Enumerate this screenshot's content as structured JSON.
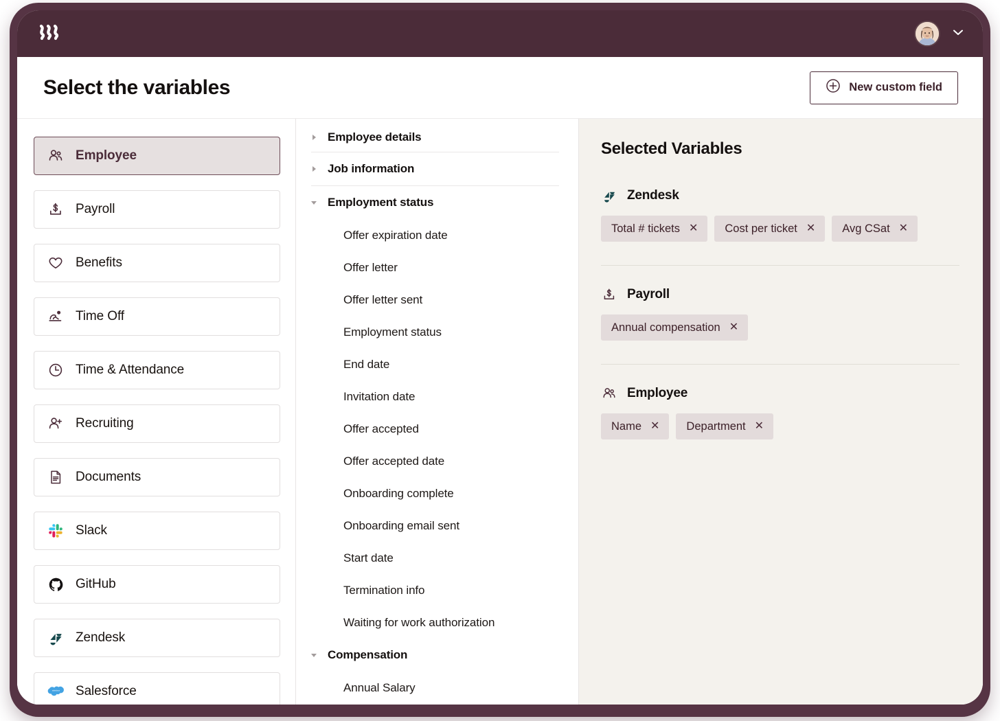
{
  "appbar": {
    "logo_name": "rippling-logo",
    "avatar_name": "user-avatar",
    "chevron_name": "chevron-down-icon"
  },
  "header": {
    "title": "Select the variables",
    "new_field_button": "New custom field",
    "new_field_icon": "plus-circle-icon"
  },
  "sidebar": {
    "items": [
      {
        "label": "Employee",
        "icon": "people-icon",
        "selected": true
      },
      {
        "label": "Payroll",
        "icon": "dollar-tray-icon",
        "selected": false
      },
      {
        "label": "Benefits",
        "icon": "heart-icon",
        "selected": false
      },
      {
        "label": "Time Off",
        "icon": "person-relax-icon",
        "selected": false
      },
      {
        "label": "Time & Attendance",
        "icon": "clock-icon",
        "selected": false
      },
      {
        "label": "Recruiting",
        "icon": "person-plus-icon",
        "selected": false
      },
      {
        "label": "Documents",
        "icon": "document-icon",
        "selected": false
      },
      {
        "label": "Slack",
        "icon": "slack-icon",
        "selected": false
      },
      {
        "label": "GitHub",
        "icon": "github-icon",
        "selected": false
      },
      {
        "label": "Zendesk",
        "icon": "zendesk-icon",
        "selected": false
      },
      {
        "label": "Salesforce",
        "icon": "salesforce-icon",
        "selected": false
      }
    ]
  },
  "variables_tree": {
    "groups": [
      {
        "label": "Employee details",
        "expanded": false,
        "items": []
      },
      {
        "label": "Job information",
        "expanded": false,
        "items": []
      },
      {
        "label": "Employment status",
        "expanded": true,
        "items": [
          "Offer expiration date",
          "Offer letter",
          "Offer letter sent",
          "Employment status",
          "End date",
          "Invitation date",
          "Offer accepted",
          "Offer accepted date",
          "Onboarding complete",
          "Onboarding email sent",
          "Start date",
          "Termination info",
          "Waiting for work authorization"
        ]
      },
      {
        "label": "Compensation",
        "expanded": true,
        "items": [
          "Annual Salary"
        ]
      }
    ]
  },
  "selected_panel": {
    "title": "Selected Variables",
    "groups": [
      {
        "label": "Zendesk",
        "icon": "zendesk-icon",
        "chips": [
          "Total # tickets",
          "Cost per ticket",
          "Avg CSat"
        ]
      },
      {
        "label": "Payroll",
        "icon": "dollar-tray-icon",
        "chips": [
          "Annual compensation"
        ]
      },
      {
        "label": "Employee",
        "icon": "people-icon",
        "chips": [
          "Name",
          "Department"
        ]
      }
    ],
    "chip_remove_glyph": "✕"
  },
  "colors": {
    "frame": "#563444",
    "appbar": "#4b2c39",
    "accent": "#4b2c39",
    "panel_bg": "#f4f2ed",
    "chip_bg": "#e3dbdb",
    "selected_nav_bg": "#e6e0e0"
  }
}
